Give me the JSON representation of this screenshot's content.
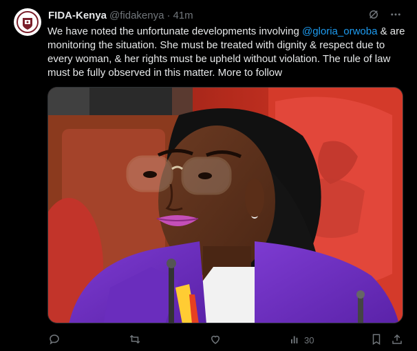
{
  "tweet": {
    "display_name": "FIDA-Kenya",
    "handle": "@fidakenya",
    "separator": "·",
    "time": "41m",
    "text_before": "We have noted the unfortunate developments involving ",
    "mention": "@gloria_orwoba",
    "text_after": " & are monitoring the situation. She must be treated with dignity & respect due to every woman, & her rights must be upheld without violation. The rule of law must be fully observed in this matter. More to follow",
    "views": "30"
  },
  "icons": {
    "avatar": "fida-logo-icon",
    "grok": "grok-icon",
    "more": "more-icon",
    "reply": "reply-icon",
    "retweet": "retweet-icon",
    "like": "like-icon",
    "views": "views-icon",
    "bookmark": "bookmark-icon",
    "share": "share-icon"
  },
  "colors": {
    "background": "#000000",
    "text": "#e7e9ea",
    "secondary": "#71767b",
    "accent": "#1d9bf0"
  }
}
